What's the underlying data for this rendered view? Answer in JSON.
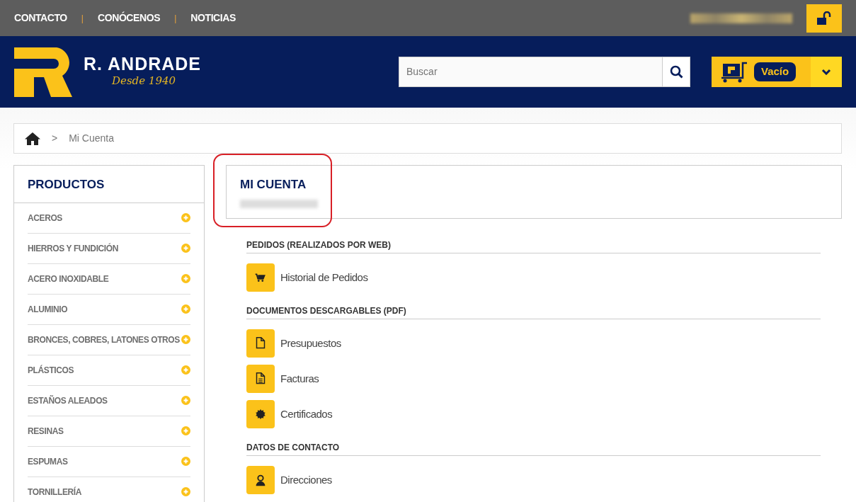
{
  "top_nav": [
    {
      "label": "CONTACTO"
    },
    {
      "label": "CONÓCENOS"
    },
    {
      "label": "NOTICIAS"
    }
  ],
  "logo": {
    "name": "R. ANDRADE",
    "tagline": "Desde 1940"
  },
  "search": {
    "placeholder": "Buscar"
  },
  "cart": {
    "label": "Vacío"
  },
  "top_nav_separator": "|",
  "breadcrumb": [
    {
      "separator": ">",
      "label": "Mi Cuenta"
    }
  ],
  "sidebar": {
    "title": "PRODUCTOS",
    "items": [
      {
        "label": "ACEROS"
      },
      {
        "label": "HIERROS Y FUNDICIÓN"
      },
      {
        "label": "ACERO INOXIDABLE"
      },
      {
        "label": "ALUMINIO"
      },
      {
        "label": "BRONCES, COBRES, LATONES OTROS"
      },
      {
        "label": "PLÁSTICOS"
      },
      {
        "label": "ESTAÑOS ALEADOS"
      },
      {
        "label": "RESINAS"
      },
      {
        "label": "ESPUMAS"
      },
      {
        "label": "TORNILLERÍA"
      }
    ]
  },
  "account": {
    "title": "MI CUENTA"
  },
  "sections": [
    {
      "title": "PEDIDOS (REALIZADOS POR WEB)",
      "links": [
        {
          "label": "Historial de Pedidos",
          "kind": "cart"
        }
      ]
    },
    {
      "title": "DOCUMENTOS DESCARGABLES (PDF)",
      "links": [
        {
          "label": "Presupuestos",
          "kind": "page"
        },
        {
          "label": "Facturas",
          "kind": "lines"
        },
        {
          "label": "Certificados",
          "kind": "seal"
        }
      ]
    },
    {
      "title": "DATOS DE CONTACTO",
      "links": [
        {
          "label": "Direcciones",
          "kind": "person"
        }
      ]
    }
  ]
}
